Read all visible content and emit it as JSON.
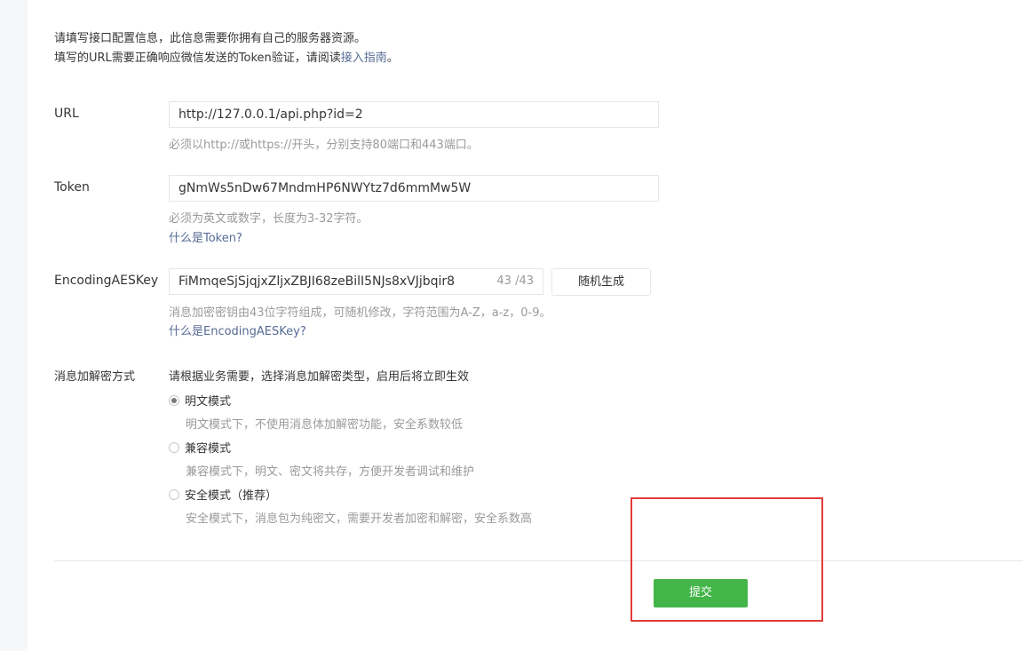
{
  "intro": {
    "line1": "请填写接口配置信息，此信息需要你拥有自己的服务器资源。",
    "line2_prefix": "填写的URL需要正确响应微信发送的Token验证，请阅读",
    "line2_link": "接入指南",
    "line2_suffix": "。"
  },
  "url": {
    "label": "URL",
    "value": "http://127.0.0.1/api.php?id=2",
    "tip": "必须以http://或https://开头，分别支持80端口和443端口。"
  },
  "token": {
    "label": "Token",
    "value": "gNmWs5nDw67MndmHP6NWYtz7d6mmMw5W",
    "tip": "必须为英文或数字，长度为3-32字符。",
    "help_link": "什么是Token?"
  },
  "aes": {
    "label": "EncodingAESKey",
    "value": "FiMmqeSjSjqjxZljxZBJI68zeBilI5NJs8xVJjbqir8",
    "counter": "43 /43",
    "generate_button": "随机生成",
    "tip": "消息加密密钥由43位字符组成，可随机修改，字符范围为A-Z，a-z，0-9。",
    "help_link": "什么是EncodingAESKey?"
  },
  "encryption": {
    "label": "消息加解密方式",
    "intro": "请根据业务需要，选择消息加解密类型，启用后将立即生效",
    "options": [
      {
        "label": "明文模式",
        "desc": "明文模式下，不使用消息体加解密功能，安全系数较低",
        "checked": true
      },
      {
        "label": "兼容模式",
        "desc": "兼容模式下，明文、密文将共存，方便开发者调试和维护",
        "checked": false
      },
      {
        "label": "安全模式（推荐）",
        "desc": "安全模式下，消息包为纯密文，需要开发者加密和解密，安全系数高",
        "checked": false
      }
    ]
  },
  "footer": {
    "submit_label": "提交"
  },
  "colors": {
    "accent_green": "#44b549",
    "link_blue": "#576b95",
    "highlight_red": "#e33b3b"
  }
}
